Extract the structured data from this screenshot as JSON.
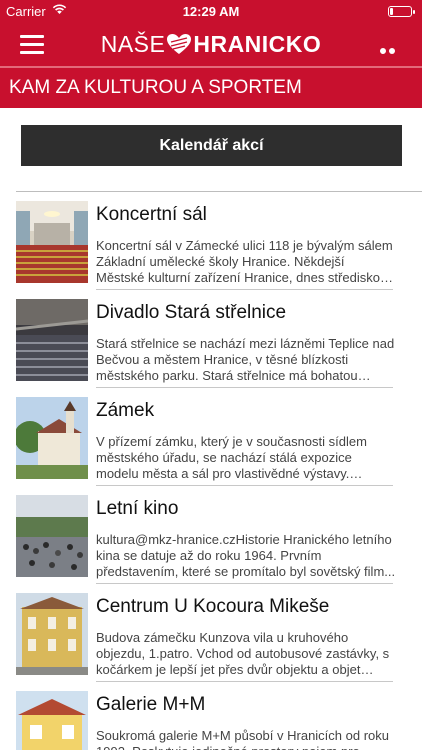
{
  "status_bar": {
    "carrier": "Carrier",
    "time": "12:29 AM"
  },
  "nav": {
    "logo_light": "NAŠE",
    "logo_bold": "HRANICKO",
    "menu_icon": "hamburger-icon",
    "more_icon": "more-dots-icon"
  },
  "section": {
    "title": "KAM ZA KULTUROU A SPORTEM"
  },
  "calendar_button": {
    "label": "Kalendář akcí"
  },
  "places": [
    {
      "name": "Koncertní sál",
      "description": "Koncertní sál v Zámecké ulici 118 je bývalým sálem Základní umělecké školy Hranice. Někdejší Městské kulturní zařízení Hranice, dnes středisko kultura, p..."
    },
    {
      "name": "Divadlo Stará střelnice",
      "description": "Stará střelnice se nachází mezi lázněmi Teplice nad Bečvou a městem Hranice, v těsné blízkosti městského parku. Stará střelnice má bohatou histo..."
    },
    {
      "name": "Zámek",
      "description": "V přízemí zámku, který je v současnosti sídlem městského úřadu, se nachází stálá expozice modelu města a sál pro vlastivědné výstavy. Severní část p..."
    },
    {
      "name": "Letní kino",
      "description": "kultura@mkz-hranice.czHistorie Hranického letního kina se datuje až do roku 1964. Prvním představením, které se promítalo byl sovětský film..."
    },
    {
      "name": "Centrum U Kocoura Mikeše",
      "description": "Budova zámečku Kunzova vila u kruhového objezdu, 1.patro. Vchod od autobusové zastávky, s kočárkem je lepší jet přes dvůr objektu a objet budovu dozadu."
    },
    {
      "name": "Galerie M+M",
      "description": "Soukromá galerie M+M působí v Hranicích od roku 1992. Poskytuje jedinečné prostory pojem pro výstavy..."
    }
  ],
  "colors": {
    "brand": "#c8102e",
    "button": "#2e2e2e"
  }
}
